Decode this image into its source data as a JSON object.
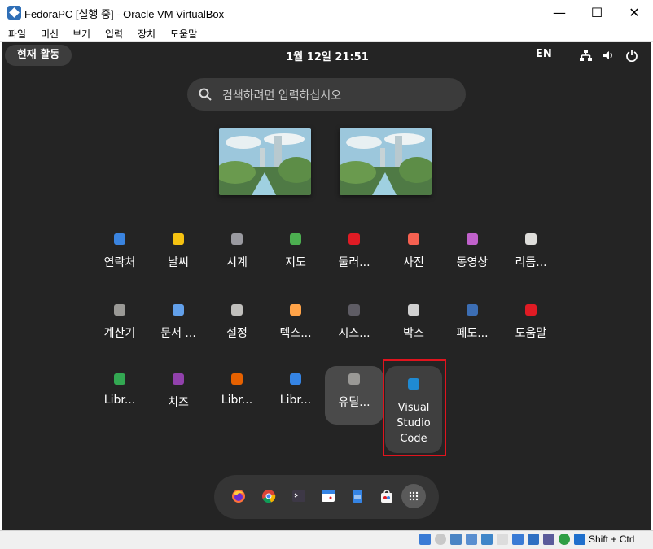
{
  "window": {
    "title": "FedoraPC [실행 중] - Oracle VM VirtualBox",
    "minimize": "—",
    "maximize": "☐",
    "close": "✕"
  },
  "menu": [
    "파일",
    "머신",
    "보기",
    "입력",
    "장치",
    "도움말"
  ],
  "topbar": {
    "activities": "현재 활동",
    "clock": "1월 12일  21:51",
    "lang": "EN"
  },
  "search": {
    "placeholder": "검색하려면 입력하십시오"
  },
  "apps": [
    {
      "label": "연락처",
      "icon": "contacts-icon",
      "color": "#3a84e0"
    },
    {
      "label": "날씨",
      "icon": "weather-icon",
      "color": "#f5c211"
    },
    {
      "label": "시계",
      "icon": "clock-icon",
      "color": "#9a9aa0"
    },
    {
      "label": "지도",
      "icon": "maps-icon",
      "color": "#4caf50"
    },
    {
      "label": "둘러...",
      "icon": "tour-icon",
      "color": "#e01b24"
    },
    {
      "label": "사진",
      "icon": "photos-icon",
      "color": "#f66151"
    },
    {
      "label": "동영상",
      "icon": "videos-icon",
      "color": "#c061cb"
    },
    {
      "label": "리듬...",
      "icon": "rhythmbox-icon",
      "color": "#deddda"
    },
    {
      "label": "계산기",
      "icon": "calculator-icon",
      "color": "#9a9996"
    },
    {
      "label": "문서 ...",
      "icon": "document-viewer-icon",
      "color": "#62a0ea"
    },
    {
      "label": "설정",
      "icon": "settings-gear-icon",
      "color": "#c0bfbc"
    },
    {
      "label": "텍스...",
      "icon": "text-editor-icon",
      "color": "#ffa348"
    },
    {
      "label": "시스...",
      "icon": "system-monitor-icon",
      "color": "#5e5c64"
    },
    {
      "label": "박스",
      "icon": "boxes-icon",
      "color": "#d0d0d0"
    },
    {
      "label": "페도...",
      "icon": "fedora-media-writer-icon",
      "color": "#3c6eb4"
    },
    {
      "label": "도움말",
      "icon": "help-lifebuoy-icon",
      "color": "#e01b24"
    },
    {
      "label": "Libr...",
      "icon": "libreoffice-calc-icon",
      "color": "#33a852"
    },
    {
      "label": "치즈",
      "icon": "cheese-icon",
      "color": "#9141ac"
    },
    {
      "label": "Libr...",
      "icon": "libreoffice-impress-icon",
      "color": "#e66100"
    },
    {
      "label": "Libr...",
      "icon": "libreoffice-writer-icon",
      "color": "#3584e4"
    },
    {
      "label": "유틸...",
      "icon": "utilities-folder-icon",
      "color": "#9a9996"
    },
    {
      "label": "Visual Studio Code",
      "icon": "vscode-icon",
      "color": "#1f8ad2"
    }
  ],
  "dock": [
    {
      "icon": "firefox-icon"
    },
    {
      "icon": "chrome-icon"
    },
    {
      "icon": "terminal-icon"
    },
    {
      "icon": "calendar-icon"
    },
    {
      "icon": "files-icon"
    },
    {
      "icon": "software-icon"
    },
    {
      "icon": "app-grid-icon"
    }
  ],
  "status": {
    "hostkey": "Shift + Ctrl"
  },
  "colors": {
    "shell_bg": "#242424",
    "highlight": "#e0141e"
  }
}
